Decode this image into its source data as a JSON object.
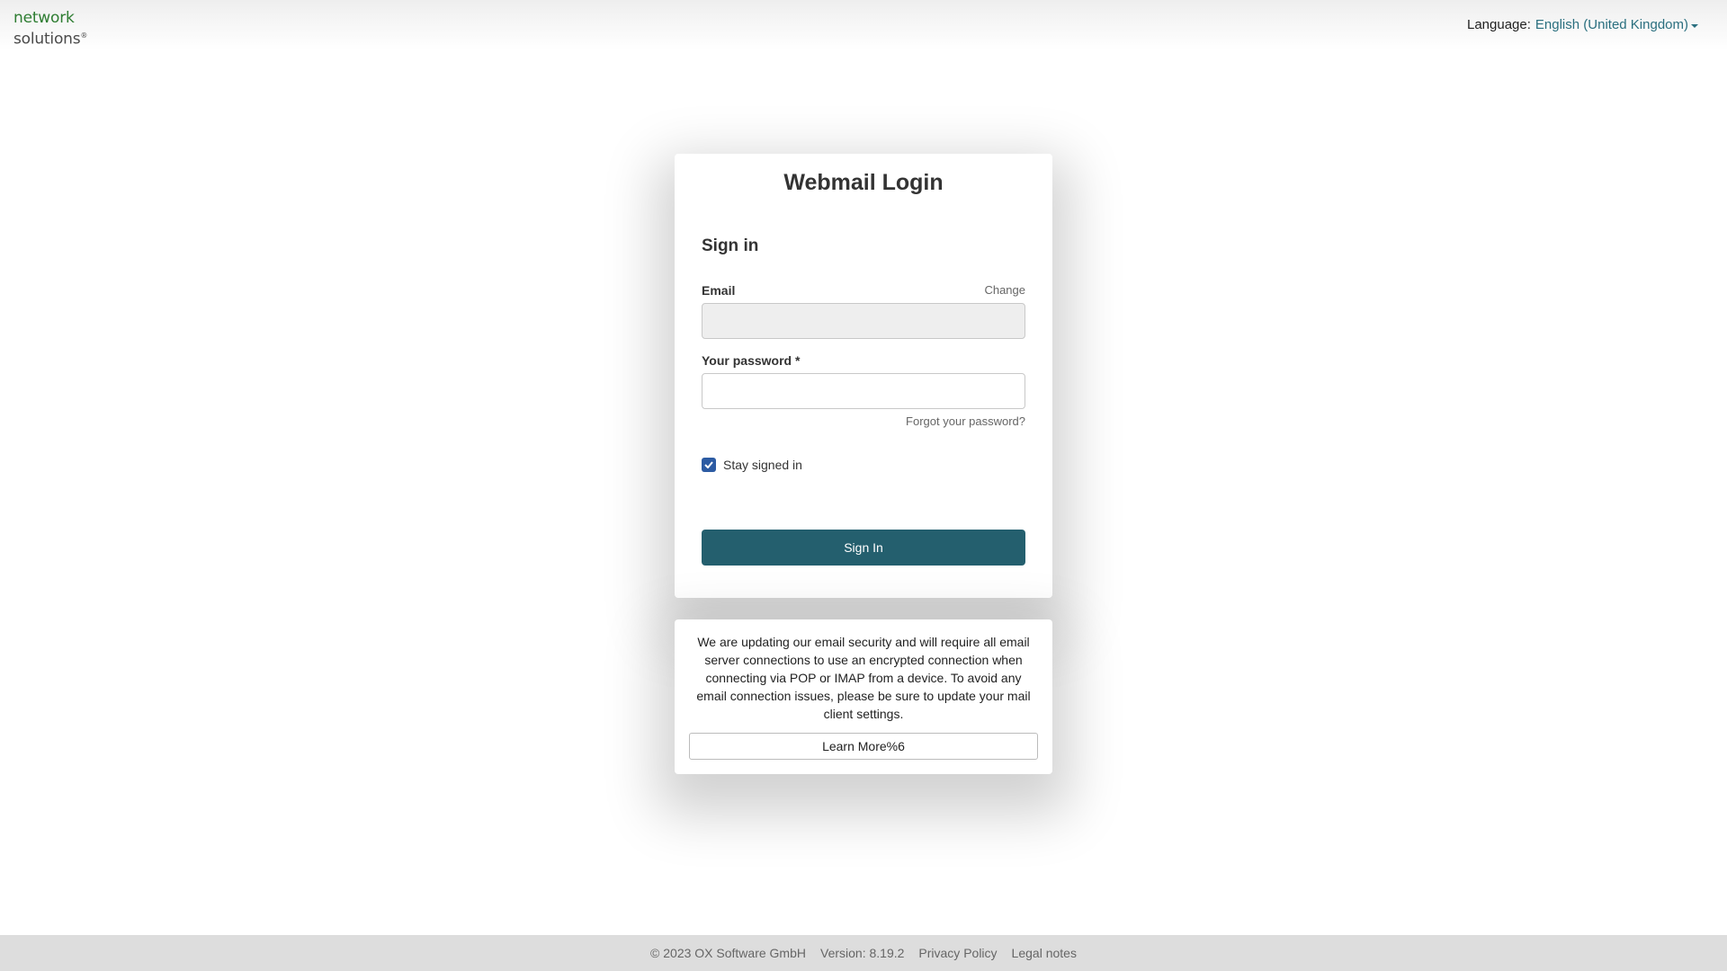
{
  "header": {
    "logo_line1": "network",
    "logo_line2": "solutions",
    "logo_mark": "®",
    "language_label": "Language:",
    "language_value": "English (United Kingdom)"
  },
  "login": {
    "title": "Webmail Login",
    "heading": "Sign in",
    "email_label": "Email",
    "change_link": "Change",
    "email_value": "",
    "password_label": "Your password *",
    "password_value": "",
    "forgot_link": "Forgot your password?",
    "stay_signed_in_label": "Stay signed in",
    "stay_signed_in_checked": true,
    "signin_button": "Sign In"
  },
  "notice": {
    "text": "We are updating our email security and will require all email server connections to use an encrypted connection when connecting via POP or IMAP from a device. To avoid any email connection issues, please be sure to update your mail client settings.",
    "button": "Learn More%6"
  },
  "footer": {
    "copyright": "© 2023 OX Software GmbH",
    "version": "Version: 8.19.2",
    "privacy": "Privacy Policy",
    "legal": "Legal notes"
  },
  "colors": {
    "accent": "#245f6e",
    "link": "#2a6f7f",
    "logo_green": "#2e7d32",
    "checkbox": "#2c5ba3"
  },
  "icons": {
    "language_dropdown": "caret-down-icon",
    "checkbox": "checkmark-icon"
  }
}
